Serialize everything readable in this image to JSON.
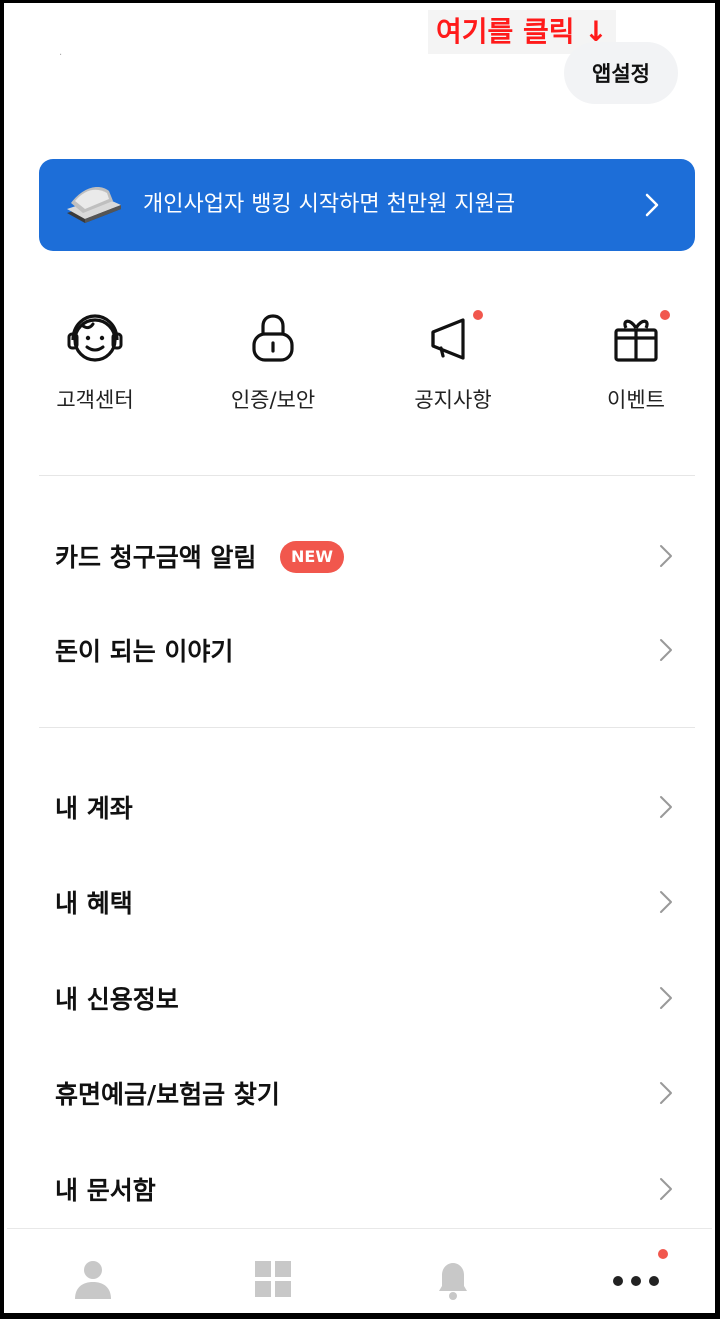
{
  "annotation": {
    "text": "여기를 클릭 ↓",
    "color": "#ff1a1a"
  },
  "header": {
    "settings_label": "앱설정"
  },
  "banner": {
    "text": "개인사업자 뱅킹 시작하면 천만원 지원금",
    "color": "#1d6ed8"
  },
  "quick_menu": [
    {
      "label": "고객센터",
      "icon": "headset-icon",
      "has_dot": false
    },
    {
      "label": "인증/보안",
      "icon": "lock-icon",
      "has_dot": false
    },
    {
      "label": "공지사항",
      "icon": "megaphone-icon",
      "has_dot": true
    },
    {
      "label": "이벤트",
      "icon": "gift-icon",
      "has_dot": true
    }
  ],
  "menu_group_1": [
    {
      "label": "카드 청구금액 알림",
      "badge": "NEW"
    },
    {
      "label": "돈이 되는 이야기"
    }
  ],
  "menu_group_2": [
    {
      "label": "내 계좌"
    },
    {
      "label": "내 혜택"
    },
    {
      "label": "내 신용정보"
    },
    {
      "label": "휴면예금/보험금 찾기"
    },
    {
      "label": "내 문서함"
    }
  ],
  "tab_bar": [
    {
      "icon": "person-icon",
      "active": false
    },
    {
      "icon": "grid-icon",
      "active": false
    },
    {
      "icon": "bell-icon",
      "active": false
    },
    {
      "icon": "more-dots-icon",
      "active": true,
      "has_dot": true
    }
  ],
  "accent_red": "#f1574d"
}
